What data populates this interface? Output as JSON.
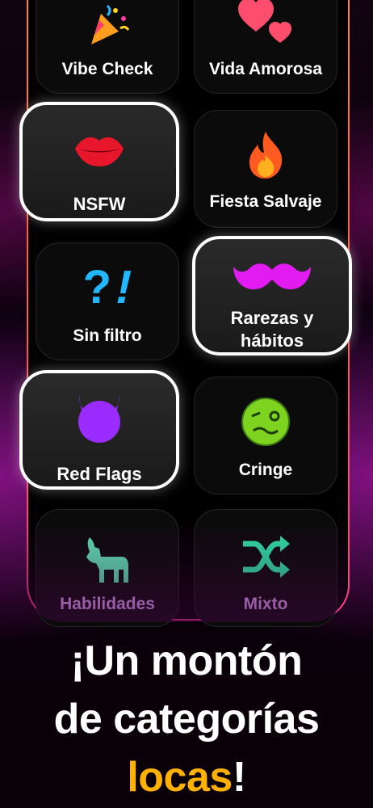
{
  "categories": [
    {
      "label": "Vibe Check",
      "icon": "party-popper-icon",
      "selected": false
    },
    {
      "label": "Vida Amorosa",
      "icon": "two-hearts-icon",
      "selected": false
    },
    {
      "label": "NSFW",
      "icon": "lips-icon",
      "selected": true
    },
    {
      "label": "Fiesta Salvaje",
      "icon": "fire-icon",
      "selected": false
    },
    {
      "label": "Sin filtro",
      "icon": "question-exclamation-icon",
      "selected": false
    },
    {
      "label": "Rarezas y hábitos",
      "icon": "mustache-icon",
      "selected": true
    },
    {
      "label": "Red Flags",
      "icon": "devil-icon",
      "selected": true
    },
    {
      "label": "Cringe",
      "icon": "woozy-face-icon",
      "selected": false
    },
    {
      "label": "Habilidades",
      "icon": "goat-icon",
      "selected": false
    },
    {
      "label": "Mixto",
      "icon": "shuffle-icon",
      "selected": false
    }
  ],
  "headline": {
    "line1": "¡Un montón",
    "line2": "de categorías",
    "highlight": "locas",
    "end": "!"
  },
  "colors": {
    "highlight": "#ffb000",
    "border_gradient": [
      "#ff8a2a",
      "#ff3e8c"
    ],
    "habilidades_label": "#e7a6ff",
    "mixto_label": "#e7a6ff"
  }
}
